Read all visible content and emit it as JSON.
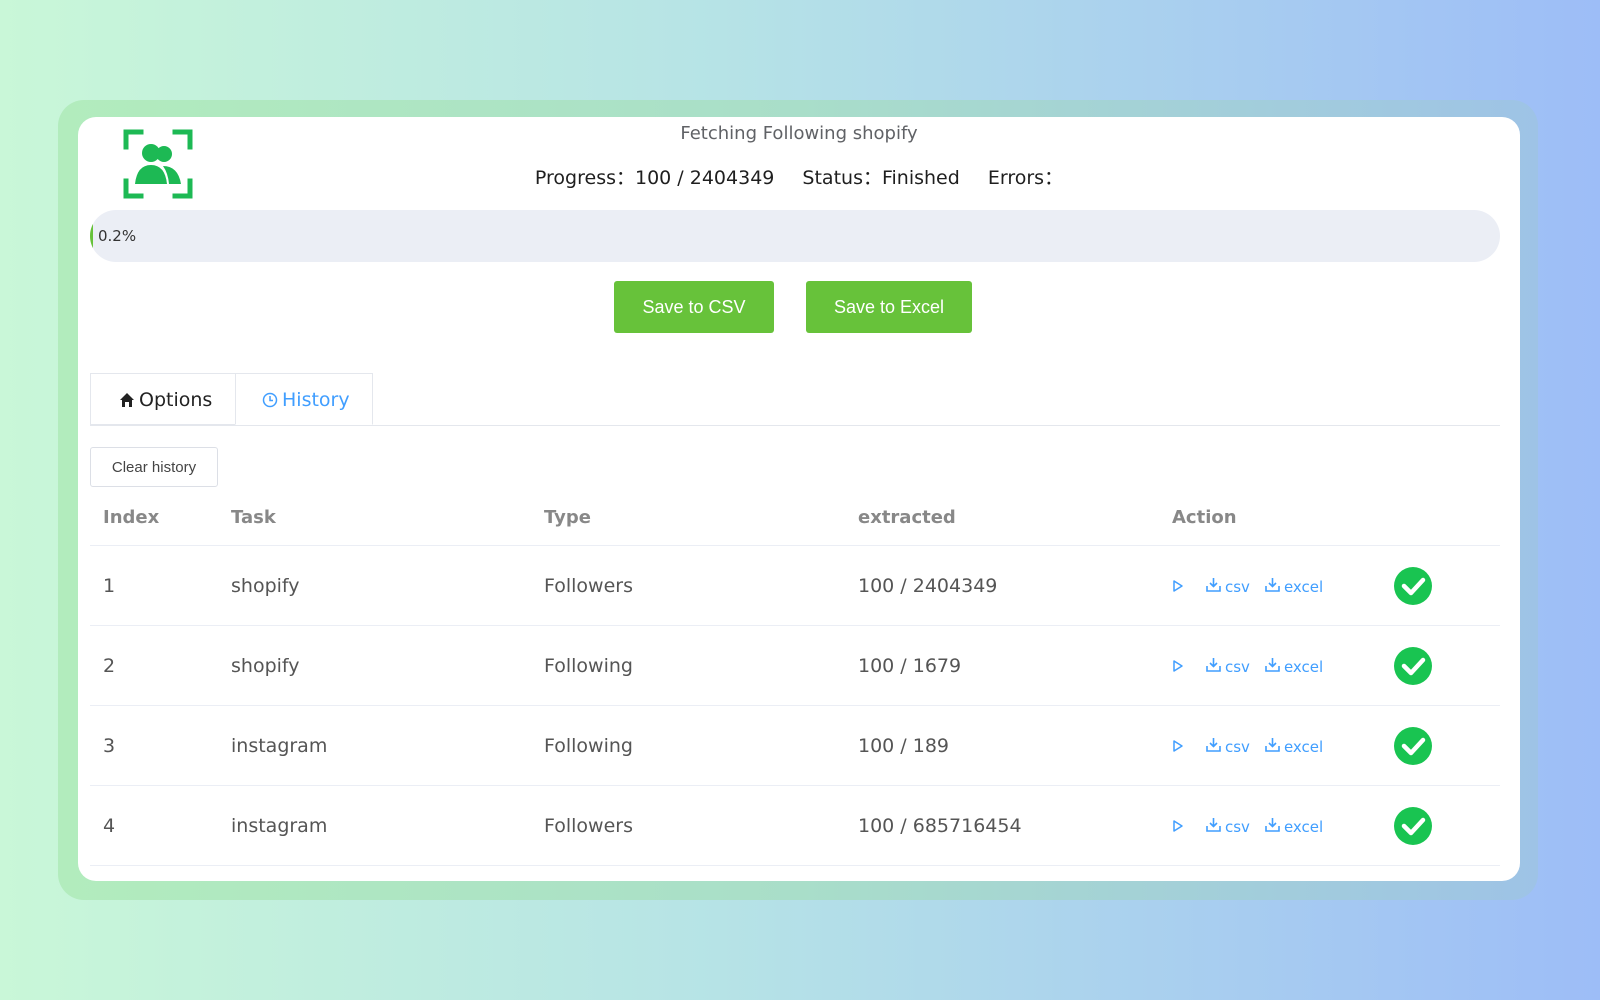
{
  "task": {
    "title": "Fetching Following shopify",
    "progress_label": "Progress：",
    "progress_value": "100 / 2404349",
    "status_label": "Status：",
    "status_value": "Finished",
    "errors_label": "Errors：",
    "errors_value": ""
  },
  "progress_bar": {
    "percent_text": "0.2%",
    "fraction": 0.002
  },
  "buttons": {
    "save_csv": "Save to CSV",
    "save_excel": "Save to Excel",
    "clear_history": "Clear history"
  },
  "tabs": [
    {
      "label": "Options",
      "icon": "home-icon",
      "active": false
    },
    {
      "label": "History",
      "icon": "clock-icon",
      "active": true
    }
  ],
  "table": {
    "headers": [
      "Index",
      "Task",
      "Type",
      "extracted",
      "Action"
    ],
    "action_labels": {
      "csv": "csv",
      "excel": "excel"
    },
    "rows": [
      {
        "index": "1",
        "task": "shopify",
        "type": "Followers",
        "extracted": "100 / 2404349"
      },
      {
        "index": "2",
        "task": "shopify",
        "type": "Following",
        "extracted": "100 / 1679"
      },
      {
        "index": "3",
        "task": "instagram",
        "type": "Following",
        "extracted": "100 / 189"
      },
      {
        "index": "4",
        "task": "instagram",
        "type": "Followers",
        "extracted": "100 / 685716454"
      }
    ]
  },
  "colors": {
    "accent_green": "#67c23a",
    "link_blue": "#409eff",
    "check_green": "#19c451",
    "logo_green": "#1db954"
  }
}
